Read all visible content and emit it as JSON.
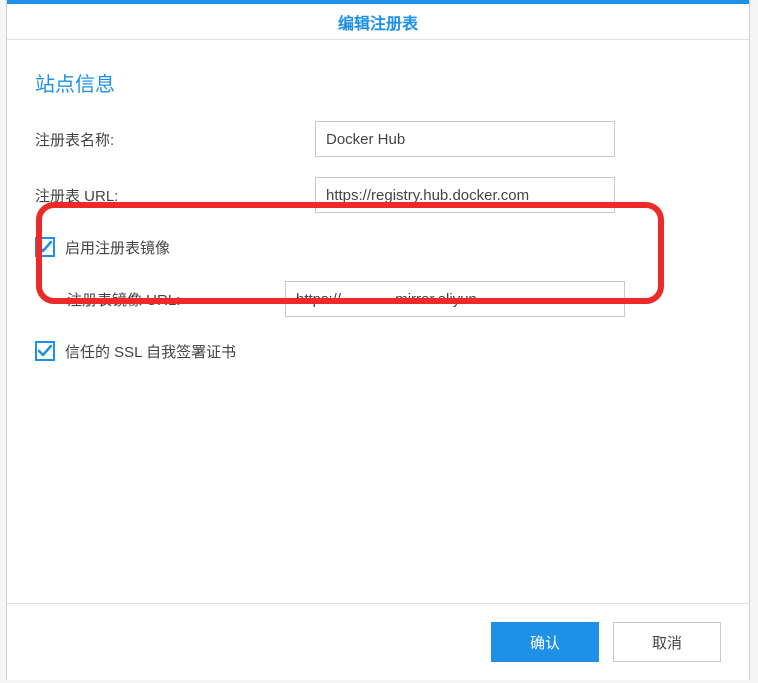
{
  "dialog": {
    "title": "编辑注册表",
    "section_title": "站点信息",
    "fields": {
      "name_label": "注册表名称:",
      "name_value": "Docker Hub",
      "url_label": "注册表 URL:",
      "url_value": "https://registry.hub.docker.com",
      "enable_mirror_label": "启用注册表镜像",
      "enable_mirror_checked": true,
      "mirror_url_label": "注册表镜像 URL:",
      "mirror_url_value": "https://            .mirror.aliyun",
      "trust_ssl_label": "信任的 SSL 自我签署证书",
      "trust_ssl_checked": true
    },
    "buttons": {
      "ok": "确认",
      "cancel": "取消"
    }
  }
}
